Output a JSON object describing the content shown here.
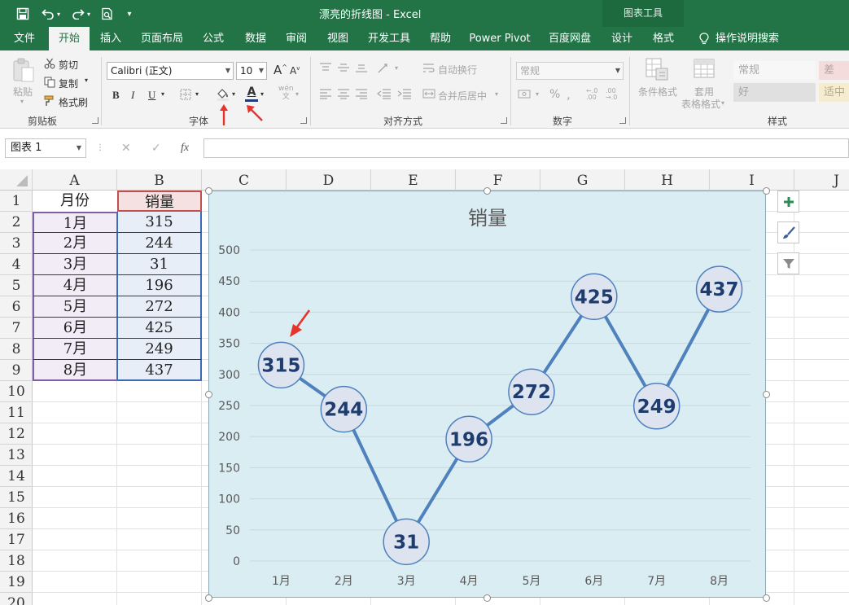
{
  "window": {
    "title": "漂亮的折线图  -  Excel",
    "context_group": "图表工具"
  },
  "quick_access": {
    "save_icon": "save-icon",
    "undo_icon": "undo-icon",
    "redo_icon": "redo-icon",
    "preview_icon": "print-preview-icon",
    "customize_icon": "customize-qat-icon"
  },
  "tabs": [
    {
      "label": "文件"
    },
    {
      "label": "开始"
    },
    {
      "label": "插入"
    },
    {
      "label": "页面布局"
    },
    {
      "label": "公式"
    },
    {
      "label": "数据"
    },
    {
      "label": "审阅"
    },
    {
      "label": "视图"
    },
    {
      "label": "开发工具"
    },
    {
      "label": "帮助"
    },
    {
      "label": "Power Pivot"
    },
    {
      "label": "百度网盘"
    },
    {
      "label": "设计"
    },
    {
      "label": "格式"
    },
    {
      "label": "操作说明搜索"
    }
  ],
  "ribbon": {
    "clipboard": {
      "group": "剪贴板",
      "paste": "粘贴",
      "cut": "剪切",
      "copy": "复制",
      "format_painter": "格式刷"
    },
    "font": {
      "group": "字体",
      "font_name": "Calibri (正文)",
      "font_size": "10",
      "bold": "B",
      "italic": "I",
      "underline": "U",
      "font_color_letter": "A",
      "wen": "wén",
      "wen2": "文"
    },
    "alignment": {
      "group": "对齐方式",
      "wrap": "自动换行",
      "merge": "合并后居中"
    },
    "number": {
      "group": "数字",
      "format": "常规",
      "percent": "%"
    },
    "styles": {
      "group": "样式",
      "conditional": "条件格式",
      "table_a": "套用",
      "table_b": "表格格式",
      "normal": "常规",
      "bad": "差",
      "good": "好",
      "neutral": "适中"
    },
    "accent_red": "#e8332a",
    "font_color_bar": "#1f3d7a"
  },
  "formula_bar": {
    "name_box": "图表 1",
    "cancel": "✕",
    "confirm": "✓",
    "fx": "fx",
    "value": ""
  },
  "sheet": {
    "columns": [
      "A",
      "B",
      "C",
      "D",
      "E",
      "F",
      "G",
      "H",
      "I",
      "J"
    ],
    "rows": [
      "1",
      "2",
      "3",
      "4",
      "5",
      "6",
      "7",
      "8",
      "9",
      "10",
      "11",
      "12",
      "13",
      "14",
      "15",
      "16",
      "17",
      "18",
      "19",
      "20"
    ],
    "header": {
      "month": "月份",
      "sales": "销量"
    },
    "data": [
      {
        "month": "1月",
        "sales": "315"
      },
      {
        "month": "2月",
        "sales": "244"
      },
      {
        "month": "3月",
        "sales": "31"
      },
      {
        "month": "4月",
        "sales": "196"
      },
      {
        "month": "5月",
        "sales": "272"
      },
      {
        "month": "6月",
        "sales": "425"
      },
      {
        "month": "7月",
        "sales": "249"
      },
      {
        "month": "8月",
        "sales": "437"
      }
    ]
  },
  "chart_side_buttons": [
    "plus-icon",
    "brush-icon",
    "filter-icon"
  ],
  "chart_data": {
    "type": "line",
    "title": "销量",
    "categories": [
      "1月",
      "2月",
      "3月",
      "4月",
      "5月",
      "6月",
      "7月",
      "8月"
    ],
    "values": [
      315,
      244,
      31,
      196,
      272,
      425,
      249,
      437
    ],
    "ylim": [
      0,
      500
    ],
    "yticks": [
      0,
      50,
      100,
      150,
      200,
      250,
      300,
      350,
      400,
      450,
      500
    ],
    "grid": true,
    "legend": "none",
    "colors": {
      "background": "#daedf3",
      "line": "#4f81bd",
      "marker_fill": "#dde4f0",
      "marker_edge": "#4f81bd",
      "label": "#1f3c6e",
      "title": "#595959",
      "gridline": "#c9d7dc",
      "axis_text": "#595959"
    }
  }
}
